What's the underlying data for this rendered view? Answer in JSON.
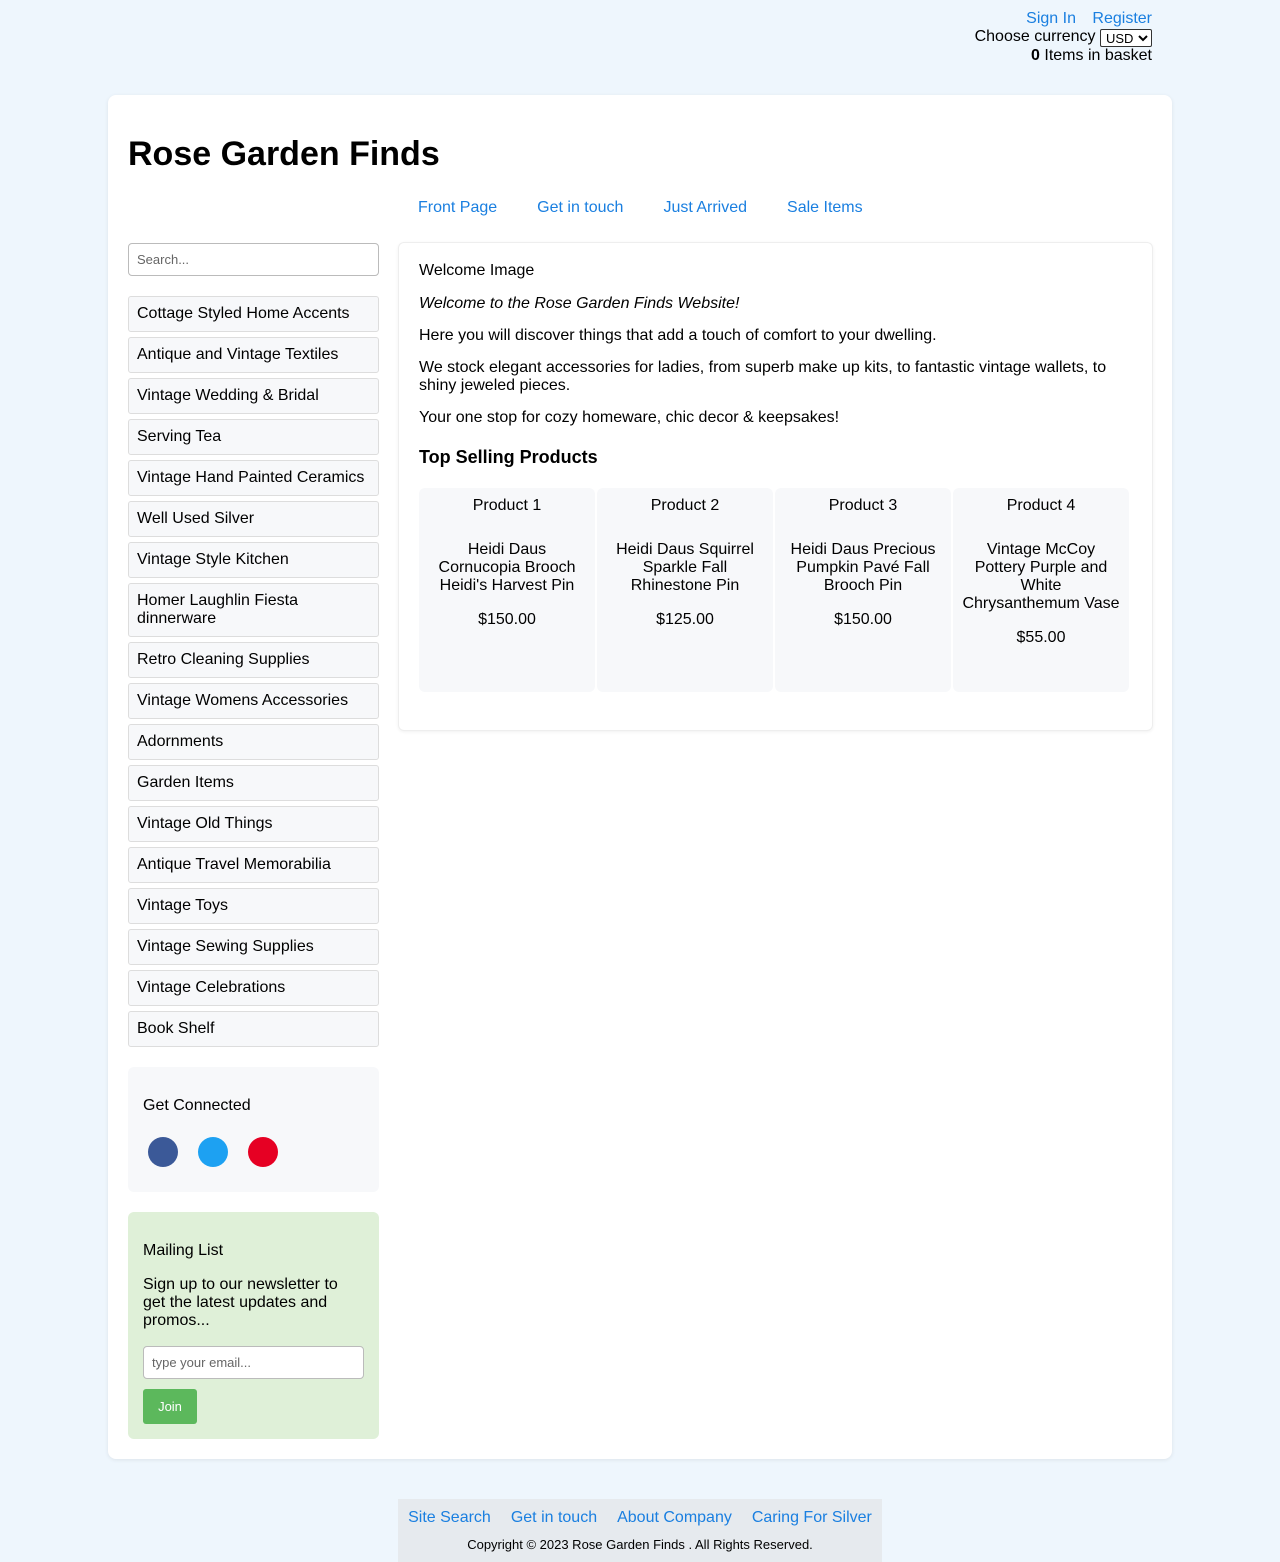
{
  "topbar": {
    "sign_in": "Sign In",
    "register": "Register",
    "currency_label": "Choose currency",
    "currency_value": "USD",
    "basket_count": "0",
    "basket_label": "Items in basket"
  },
  "site": {
    "title": "Rose Garden Finds"
  },
  "nav": {
    "items": [
      {
        "label": "Front Page"
      },
      {
        "label": "Get in touch"
      },
      {
        "label": "Just Arrived"
      },
      {
        "label": "Sale Items"
      }
    ]
  },
  "sidebar": {
    "search_placeholder": "Search...",
    "categories": [
      {
        "label": "Cottage Styled Home Accents"
      },
      {
        "label": "Antique and Vintage Textiles"
      },
      {
        "label": "Vintage Wedding & Bridal"
      },
      {
        "label": "Serving Tea"
      },
      {
        "label": "Vintage Hand Painted Ceramics"
      },
      {
        "label": "Well Used Silver"
      },
      {
        "label": "Vintage Style Kitchen"
      },
      {
        "label": "Homer Laughlin Fiesta dinnerware"
      },
      {
        "label": "Retro Cleaning Supplies"
      },
      {
        "label": "Vintage Womens Accessories"
      },
      {
        "label": "Adornments"
      },
      {
        "label": "Garden Items"
      },
      {
        "label": "Vintage Old Things"
      },
      {
        "label": "Antique Travel Memorabilia"
      },
      {
        "label": "Vintage Toys"
      },
      {
        "label": "Vintage Sewing Supplies"
      },
      {
        "label": "Vintage Celebrations"
      },
      {
        "label": "Book Shelf"
      }
    ],
    "connected_title": "Get Connected",
    "social": [
      {
        "icon": "facebook-icon",
        "color": "#3b5998"
      },
      {
        "icon": "twitter-icon",
        "color": "#1da1f2"
      },
      {
        "icon": "pinterest-icon",
        "color": "#e60023"
      }
    ],
    "mailing_title": "Mailing List",
    "mailing_text": "Sign up to our newsletter to get the latest updates and promos...",
    "email_placeholder": "type your email...",
    "join_label": "Join"
  },
  "main": {
    "welcome_image_alt": "Welcome Image",
    "intro": "Welcome to the Rose Garden Finds Website!",
    "para1": "Here you will discover things that add a touch of comfort to your dwelling.",
    "para2": "We stock elegant accessories for ladies, from superb make up kits, to fantastic vintage wallets, to shiny jeweled pieces.",
    "para3": "Your one stop for cozy homeware, chic decor & keepsakes!",
    "top_title": "Top Selling Products",
    "products": [
      {
        "image_alt": "Product 1",
        "name": "Heidi Daus Cornucopia Brooch Heidi's Harvest Pin",
        "price": "$150.00"
      },
      {
        "image_alt": "Product 2",
        "name": "Heidi Daus Squirrel Sparkle Fall Rhinestone Pin",
        "price": "$125.00"
      },
      {
        "image_alt": "Product 3",
        "name": "Heidi Daus Precious Pumpkin Pavé Fall Brooch Pin",
        "price": "$150.00"
      },
      {
        "image_alt": "Product 4",
        "name": "Vintage McCoy Pottery Purple and White Chrysanthemum Vase",
        "price": "$55.00"
      }
    ]
  },
  "footer": {
    "links": [
      {
        "label": "Site Search"
      },
      {
        "label": "Get in touch"
      },
      {
        "label": "About Company"
      },
      {
        "label": "Caring For Silver"
      }
    ],
    "copyright": "Copyright © 2023 Rose Garden Finds . All Rights Reserved."
  },
  "colors": {
    "background": "#eef6fd",
    "link": "#1a7fe0",
    "join_button": "#5cb85c",
    "mailing_bg": "#dff0d8"
  }
}
